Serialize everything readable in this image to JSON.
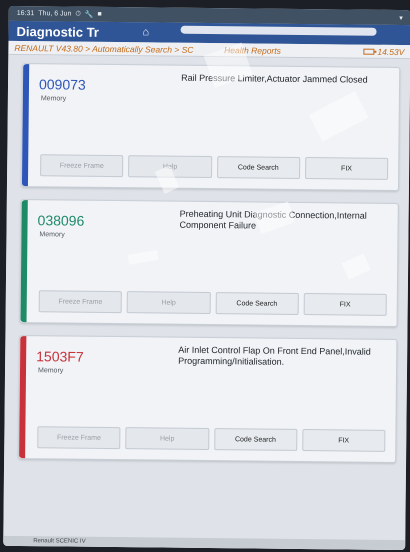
{
  "status": {
    "time": "16:31",
    "date": "Thu, 6 Jun"
  },
  "header": {
    "title": "Diagnostic Tr"
  },
  "breadcrumb": {
    "text": "RENAULT V43.80 > Automatically Search > SC",
    "tail": "Health Reports",
    "voltage": "14.53V"
  },
  "colors": {
    "header": "#2f5596",
    "breadcrumb": "#c46b1a",
    "card1_accent": "#2e56b8",
    "card2_accent": "#1e8a66",
    "card3_accent": "#c8323a"
  },
  "cards": [
    {
      "code": "009073",
      "memory": "Memory",
      "desc": "Rail Pressure Limiter,Actuator Jammed Closed",
      "buttons": [
        "Freeze Frame",
        "Help",
        "Code Search",
        "FIX"
      ]
    },
    {
      "code": "038096",
      "memory": "Memory",
      "desc": "Preheating Unit Diagnostic Connection,Internal Component Failure",
      "buttons": [
        "Freeze Frame",
        "Help",
        "Code Search",
        "FIX"
      ]
    },
    {
      "code": "1503F7",
      "memory": "Memory",
      "desc": "Air Inlet Control Flap On Front End Panel,Invalid Programming/Initialisation.",
      "buttons": [
        "Freeze Frame",
        "Help",
        "Code Search",
        "FIX"
      ]
    }
  ],
  "footer": {
    "text": "Renault SCENIC IV"
  }
}
